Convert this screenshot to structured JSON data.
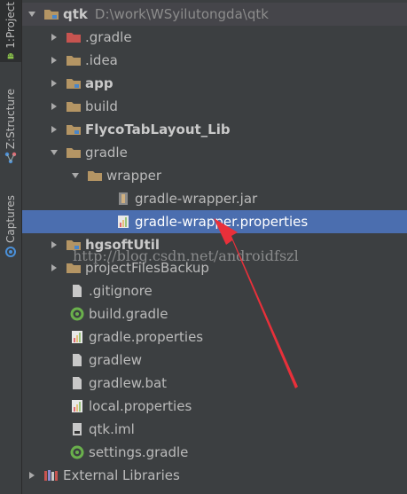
{
  "side_tabs": {
    "project": "1:Project",
    "structure": "Z:Structure",
    "captures": "Captures"
  },
  "tree": {
    "root": {
      "label": "qtk",
      "path": "D:\\work\\WSyilutongda\\qtk"
    },
    "items": [
      {
        "label": "gradle",
        "prefix": ".",
        "bold": false
      },
      {
        "label": ".idea",
        "bold": false
      },
      {
        "label": "app",
        "bold": true
      },
      {
        "label": "build",
        "bold": false
      },
      {
        "label": "FlycoTabLayout_Lib",
        "bold": true
      },
      {
        "label": "gradle",
        "bold": false
      },
      {
        "label": "wrapper",
        "bold": false
      },
      {
        "label": "gradle-wrapper.jar",
        "bold": false
      },
      {
        "label": "gradle-wrapper.properties",
        "bold": false
      },
      {
        "label": "hgsoftUtil",
        "bold": true
      },
      {
        "label": "projectFilesBackup",
        "bold": false
      },
      {
        "label": ".gitignore",
        "bold": false
      },
      {
        "label": "build.gradle",
        "bold": false
      },
      {
        "label": "gradle.properties",
        "bold": false
      },
      {
        "label": "gradlew",
        "bold": false
      },
      {
        "label": "gradlew.bat",
        "bold": false
      },
      {
        "label": "local.properties",
        "bold": false
      },
      {
        "label": "qtk.iml",
        "bold": false
      },
      {
        "label": "settings.gradle",
        "bold": false
      }
    ],
    "external": "External Libraries"
  },
  "watermark": "http://blog.csdn.net/androidfszl",
  "colors": {
    "background": "#3c3f41",
    "selection": "#4b6eaf",
    "folder": "#b49564",
    "annotation_arrow": "#e8303a"
  }
}
